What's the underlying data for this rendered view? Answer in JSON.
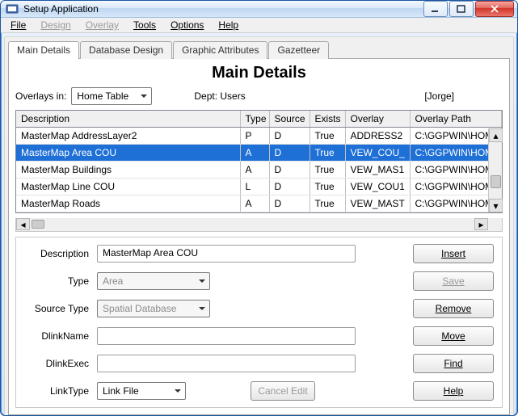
{
  "window": {
    "title": "Setup Application"
  },
  "menu": {
    "file": "File",
    "design": "Design",
    "overlay": "Overlay",
    "tools": "Tools",
    "options": "Options",
    "help": "Help"
  },
  "tabs": {
    "main_details": "Main Details",
    "database_design": "Database Design",
    "graphic_attributes": "Graphic Attributes",
    "gazetteer": "Gazetteer"
  },
  "main": {
    "title": "Main Details",
    "overlays_in_label": "Overlays in:",
    "overlays_in_value": "Home Table",
    "dept_label": "Dept: Users",
    "user_bracket": "[Jorge]",
    "columns": {
      "description": "Description",
      "type": "Type",
      "source": "Source",
      "exists": "Exists",
      "overlay": "Overlay",
      "overlay_path": "Overlay Path"
    },
    "rows": [
      {
        "description": "MasterMap AddressLayer2",
        "type": "P",
        "source": "D",
        "exists": "True",
        "overlay": "ADDRESS2",
        "overlay_path": "C:\\GGPWIN\\HOME\\"
      },
      {
        "description": "MasterMap Area COU",
        "type": "A",
        "source": "D",
        "exists": "True",
        "overlay": "VEW_COU_",
        "overlay_path": "C:\\GGPWIN\\HOME\\"
      },
      {
        "description": "MasterMap Buildings",
        "type": "A",
        "source": "D",
        "exists": "True",
        "overlay": "VEW_MAS1",
        "overlay_path": "C:\\GGPWIN\\HOME\\"
      },
      {
        "description": "MasterMap Line COU",
        "type": "L",
        "source": "D",
        "exists": "True",
        "overlay": "VEW_COU1",
        "overlay_path": "C:\\GGPWIN\\HOME\\"
      },
      {
        "description": "MasterMap Roads",
        "type": "A",
        "source": "D",
        "exists": "True",
        "overlay": "VEW_MAST",
        "overlay_path": "C:\\GGPWIN\\HOME\\"
      }
    ]
  },
  "form": {
    "description_label": "Description",
    "description_value": "MasterMap Area COU",
    "type_label": "Type",
    "type_value": "Area",
    "source_type_label": "Source Type",
    "source_type_value": "Spatial Database",
    "dlinkname_label": "DlinkName",
    "dlinkname_value": "",
    "dlinkexec_label": "DlinkExec",
    "dlinkexec_value": "",
    "linktype_label": "LinkType",
    "linktype_value": "Link File",
    "cancel_edit": "Cancel Edit",
    "buttons": {
      "insert": "Insert",
      "save": "Save",
      "remove": "Remove",
      "move": "Move",
      "find": "Find",
      "help": "Help"
    }
  }
}
